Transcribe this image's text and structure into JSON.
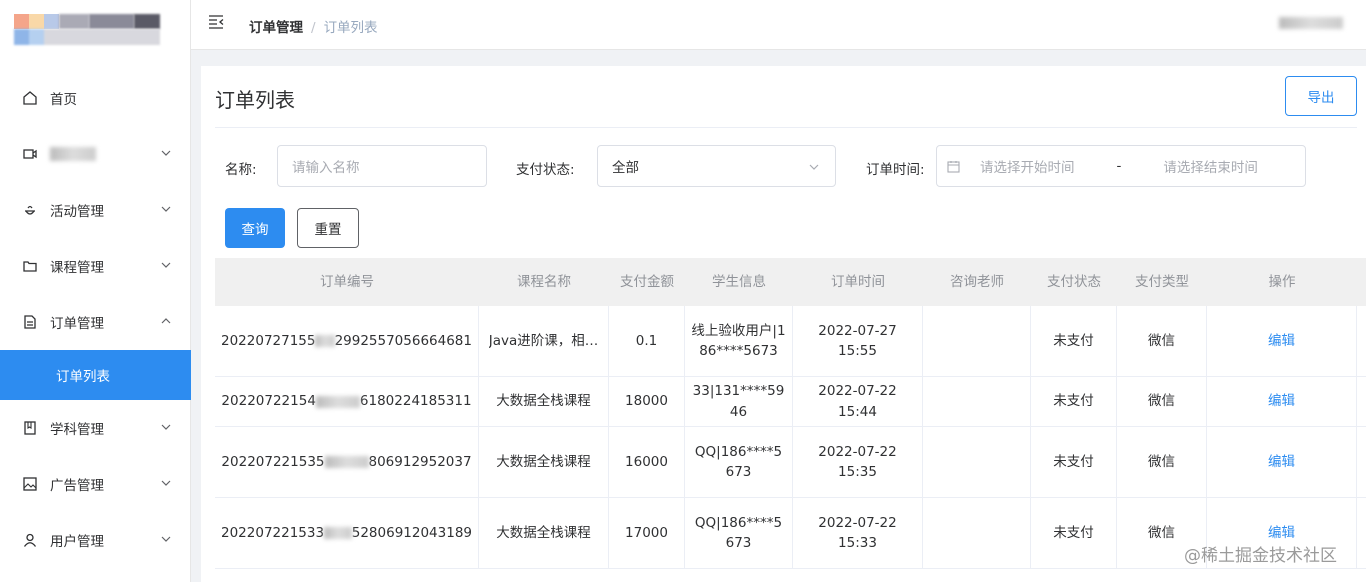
{
  "sidebar": {
    "items": [
      {
        "label": "首页",
        "icon": "home-icon",
        "expand": ""
      },
      {
        "label": "",
        "icon": "video-icon",
        "expand": "down",
        "redacted": true
      },
      {
        "label": "活动管理",
        "icon": "activity-icon",
        "expand": "down"
      },
      {
        "label": "课程管理",
        "icon": "folder-icon",
        "expand": "down"
      },
      {
        "label": "订单管理",
        "icon": "document-icon",
        "expand": "up"
      },
      {
        "label": "订单列表",
        "icon": "",
        "expand": "",
        "active": true
      },
      {
        "label": "学科管理",
        "icon": "notebook-icon",
        "expand": "down"
      },
      {
        "label": "广告管理",
        "icon": "picture-icon",
        "expand": "down"
      },
      {
        "label": "用户管理",
        "icon": "user-icon",
        "expand": "down"
      }
    ]
  },
  "header": {
    "breadcrumb": {
      "parent": "订单管理",
      "separator": "/",
      "current": "订单列表"
    }
  },
  "main": {
    "title": "订单列表",
    "export_label": "导出",
    "filters": {
      "name_label": "名称:",
      "name_placeholder": "请输入名称",
      "status_label": "支付状态:",
      "status_value": "全部",
      "time_label": "订单时间:",
      "time_start_placeholder": "请选择开始时间",
      "time_sep": "-",
      "time_end_placeholder": "请选择结束时间"
    },
    "query_label": "查询",
    "reset_label": "重置"
  },
  "table": {
    "columns": [
      "订单编号",
      "课程名称",
      "支付金额",
      "学生信息",
      "订单时间",
      "咨询老师",
      "支付状态",
      "支付类型",
      "操作"
    ],
    "rows": [
      {
        "id_pre": "20220727155",
        "id_post": "2992557056664681",
        "course": "Java进阶课，相…",
        "amount": "0.1",
        "student": "线上验收用户|186****5673",
        "time": "2022-07-27 15:55",
        "teacher": "",
        "status": "未支付",
        "type": "微信",
        "action": "编辑"
      },
      {
        "id_pre": "20220722154",
        "id_post": "6180224185311",
        "course": "大数据全栈课程",
        "amount": "18000",
        "student": "33|131****5946",
        "time": "2022-07-22 15:44",
        "teacher": "",
        "status": "未支付",
        "type": "微信",
        "action": "编辑"
      },
      {
        "id_pre": "202207221535",
        "id_post": "806912952037",
        "course": "大数据全栈课程",
        "amount": "16000",
        "student": "QQ|186****5673",
        "time": "2022-07-22 15:35",
        "teacher": "",
        "status": "未支付",
        "type": "微信",
        "action": "编辑"
      },
      {
        "id_pre": "202207221533",
        "id_post": "52806912043189",
        "course": "大数据全栈课程",
        "amount": "17000",
        "student": "QQ|186****5673",
        "time": "2022-07-22 15:33",
        "teacher": "",
        "status": "未支付",
        "type": "微信",
        "action": "编辑"
      }
    ]
  },
  "watermark": "@稀土掘金技术社区",
  "colors": {
    "primary": "#2d8cf0",
    "border": "#dcdfe6",
    "header_bg": "#f0f0f0"
  }
}
